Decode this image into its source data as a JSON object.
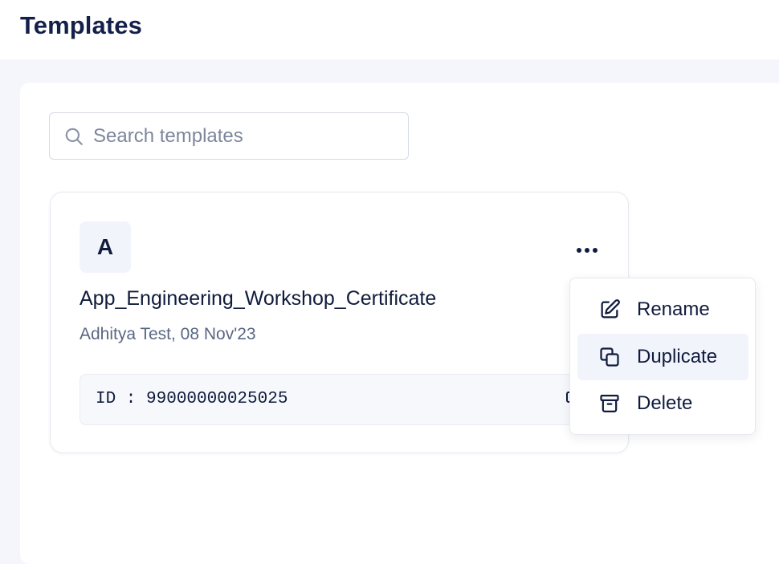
{
  "header": {
    "title": "Templates"
  },
  "search": {
    "placeholder": "Search templates",
    "value": "",
    "icon": "search-icon"
  },
  "template_card": {
    "avatar_letter": "A",
    "name": "App_Engineering_Workshop_Certificate",
    "meta": "Adhitya Test, 08 Nov'23",
    "id_text": "ID : 99000000025025",
    "more_icon": "more-horizontal-icon",
    "copy_icon": "copy-icon"
  },
  "context_menu": {
    "items": [
      {
        "label": "Rename",
        "icon": "edit-icon",
        "highlighted": false
      },
      {
        "label": "Duplicate",
        "icon": "duplicate-icon",
        "highlighted": true
      },
      {
        "label": "Delete",
        "icon": "archive-icon",
        "highlighted": false
      }
    ]
  },
  "colors": {
    "text_primary": "#101b3d",
    "text_secondary": "#5a6783",
    "page_background": "#f4f6fb",
    "surface": "#ffffff",
    "highlight": "#f1f4fb"
  }
}
